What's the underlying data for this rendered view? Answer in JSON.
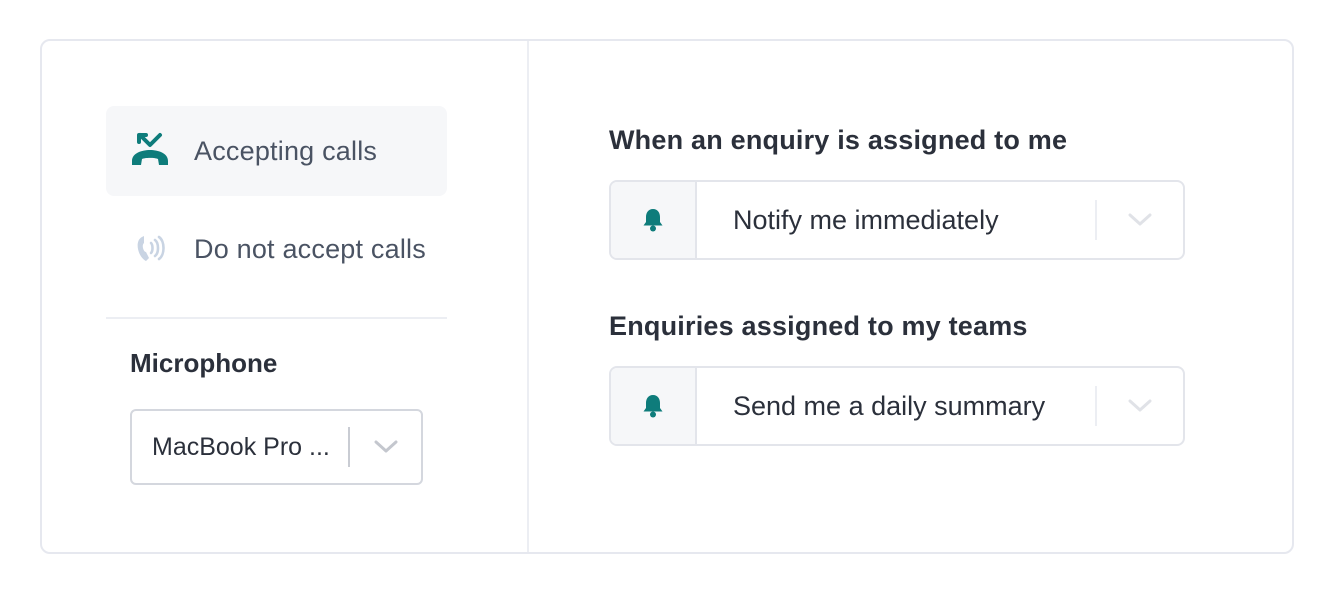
{
  "call_status": {
    "options": [
      {
        "label": "Accepting calls",
        "icon": "phone-hangup-icon",
        "active": true
      },
      {
        "label": "Do not accept calls",
        "icon": "phone-ringing-icon",
        "active": false
      }
    ]
  },
  "microphone": {
    "title": "Microphone",
    "selected": "MacBook Pro ..."
  },
  "notifications": {
    "assigned_to_me": {
      "heading": "When an enquiry is assigned to me",
      "selected": "Notify me immediately"
    },
    "assigned_to_teams": {
      "heading": "Enquiries assigned to my teams",
      "selected": "Send me a daily summary"
    }
  },
  "colors": {
    "accent": "#0e7c7b",
    "muted_icon": "#c9d4e3"
  }
}
